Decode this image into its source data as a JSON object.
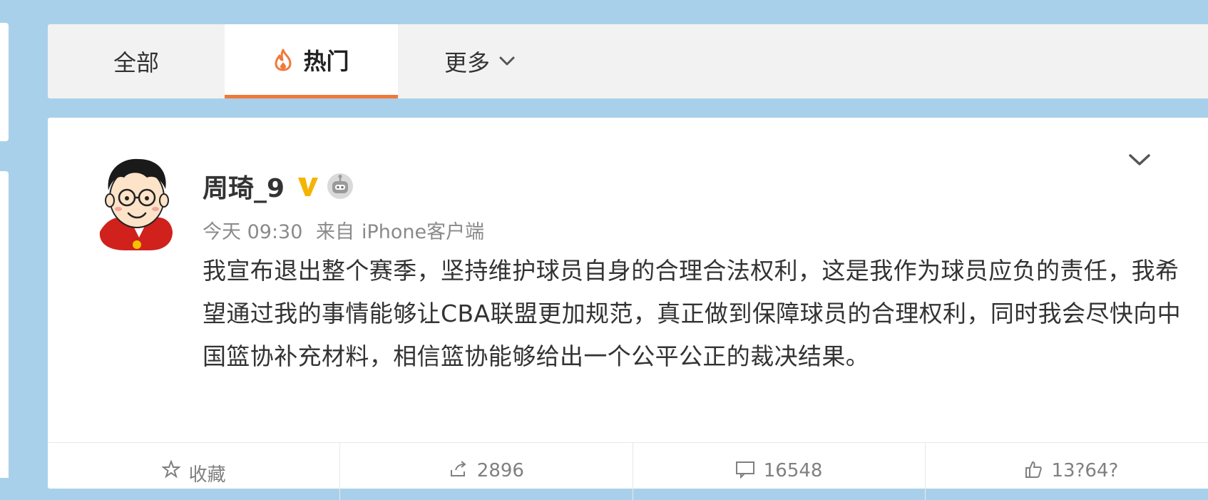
{
  "tabs": {
    "all": "全部",
    "hot": "热门",
    "more": "更多"
  },
  "post": {
    "username": "周琦_9",
    "time": "今天 09:30",
    "source_prefix": "来自",
    "source": "iPhone客户端",
    "text": "我宣布退出整个赛季，坚持维护球员自身的合理合法权利，这是我作为球员应负的责任，我希望通过我的事情能够让CBA联盟更加规范，真正做到保障球员的合理权利，同时我会尽快向中国篮协补充材料，相信篮协能够给出一个公平公正的裁决结果。"
  },
  "actions": {
    "favorite": "收藏",
    "repost": "2896",
    "comment": "16548",
    "like": "13?64?"
  },
  "colors": {
    "background": "#a9d0ea",
    "accent": "#f0793a",
    "vip": "#f5b400"
  },
  "icons": [
    "flame-icon",
    "chevron-down-icon",
    "vip-badge-icon",
    "robot-icon",
    "star-icon",
    "repost-icon",
    "comment-icon",
    "like-icon"
  ]
}
